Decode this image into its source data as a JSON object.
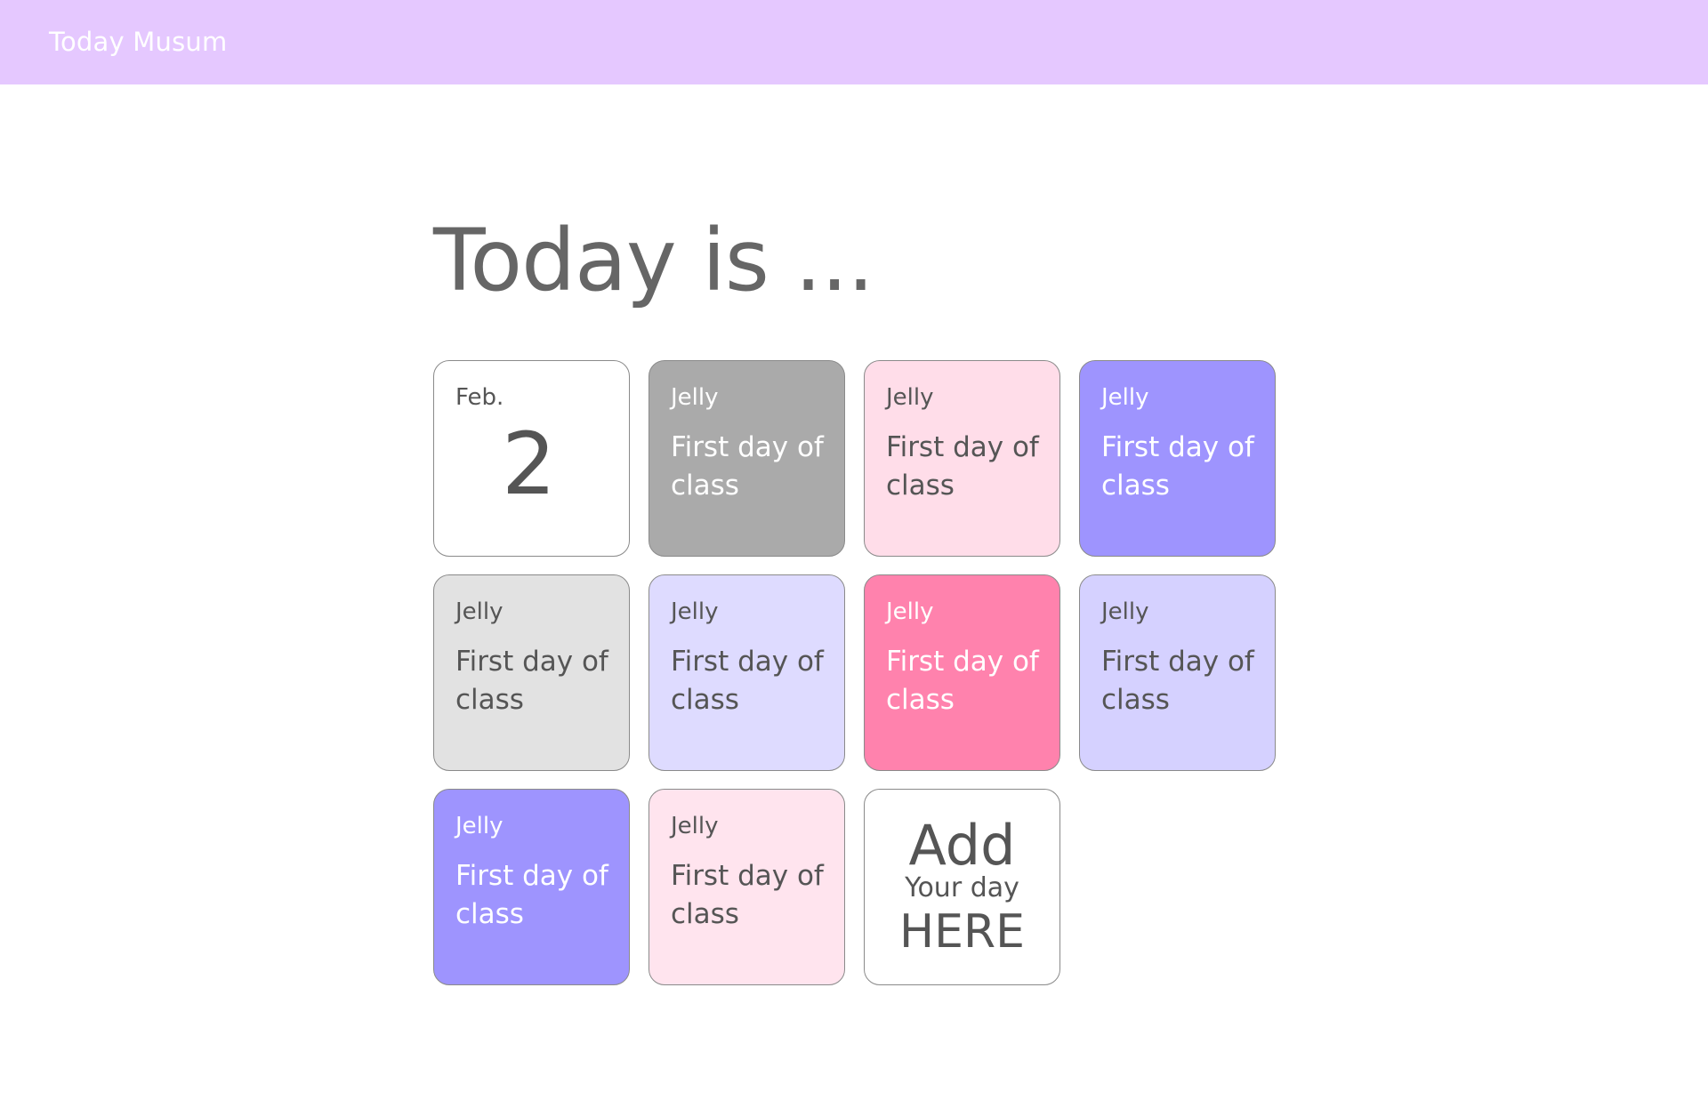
{
  "header": {
    "app_title": "Today Musum",
    "background": "#e5c8ff"
  },
  "main": {
    "page_title": "Today is ..."
  },
  "date_tile": {
    "month": "Feb.",
    "day": "2"
  },
  "tiles": [
    {
      "label": "Jelly",
      "desc": "First day of class",
      "color": "#aaaaaa",
      "text": "light"
    },
    {
      "label": "Jelly",
      "desc": "First day of class",
      "color": "#ffdde9",
      "text": "dark"
    },
    {
      "label": "Jelly",
      "desc": "First day of class",
      "color": "#9e94fe",
      "text": "light"
    },
    {
      "label": "Jelly",
      "desc": "First day of class",
      "color": "#e2e2e2",
      "text": "dark"
    },
    {
      "label": "Jelly",
      "desc": "First day of class",
      "color": "#dedbff",
      "text": "dark"
    },
    {
      "label": "Jelly",
      "desc": "First day of class",
      "color": "#ff82ad",
      "text": "light"
    },
    {
      "label": "Jelly",
      "desc": "First day of class",
      "color": "#d5d1ff",
      "text": "dark"
    },
    {
      "label": "Jelly",
      "desc": "First day of class",
      "color": "#9e94fe",
      "text": "light"
    },
    {
      "label": "Jelly",
      "desc": "First day of class",
      "color": "#ffe4ee",
      "text": "dark"
    }
  ],
  "add_tile": {
    "line1": "Add",
    "line2": "Your day",
    "line3": "HERE"
  }
}
